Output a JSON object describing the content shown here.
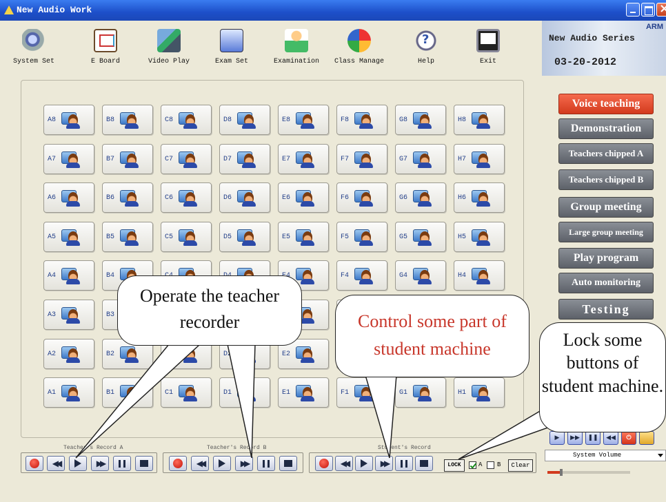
{
  "window": {
    "title": "New Audio Work"
  },
  "toolbar": [
    {
      "label": "System Set",
      "icon": "system-settings-icon"
    },
    {
      "label": "E Board",
      "icon": "electronic-board-icon"
    },
    {
      "label": "Video Play",
      "icon": "video-play-icon"
    },
    {
      "label": "Exam Set",
      "icon": "exam-set-icon"
    },
    {
      "label": "Examination",
      "icon": "examination-icon"
    },
    {
      "label": "Class Manage",
      "icon": "class-manage-icon"
    },
    {
      "label": "Help",
      "icon": "help-icon"
    },
    {
      "label": "Exit",
      "icon": "exit-monitor-icon"
    }
  ],
  "brand": {
    "corner": "ARM",
    "series": "New Audio Series",
    "date": "03-20-2012"
  },
  "seat_grid": {
    "columns": [
      "A",
      "B",
      "C",
      "D",
      "E",
      "F",
      "G",
      "H"
    ],
    "rows": [
      "8",
      "7",
      "6",
      "5",
      "4",
      "3",
      "2",
      "1"
    ]
  },
  "modes": [
    {
      "label": "Voice teaching",
      "active": true
    },
    {
      "label": "Demonstration",
      "active": false
    },
    {
      "label": "Teachers chipped A",
      "active": false
    },
    {
      "label": "Teachers chipped B",
      "active": false
    },
    {
      "label": "Group meeting",
      "active": false
    },
    {
      "label": "Large group meeting",
      "active": false
    },
    {
      "label": "Play program",
      "active": false
    },
    {
      "label": "Auto monitoring",
      "active": false
    },
    {
      "label": "Testing",
      "active": false
    }
  ],
  "records": {
    "teacher_a": "Teacher's Record A",
    "teacher_b": "Teacher's Record B",
    "student": "Student's Record"
  },
  "lock": {
    "label": "LOCK",
    "a_label": "A",
    "a_checked": true,
    "b_label": "B",
    "b_checked": false,
    "clear_label": "Clear"
  },
  "volume": {
    "label": "System Volume",
    "level": 0.15
  },
  "callouts": {
    "teacher": "Operate the teacher recorder",
    "student": "Control some part of student machine",
    "lock": "Lock some buttons of student machine."
  },
  "colors": {
    "active_mode": "#e04a2c",
    "inactive_mode": "#6e737b",
    "callout_red": "#c8372b",
    "titlebar": "#245edb"
  }
}
